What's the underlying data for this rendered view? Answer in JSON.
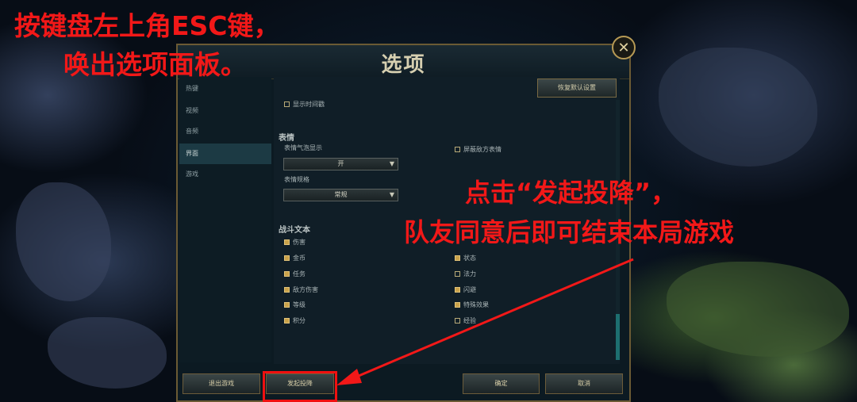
{
  "annotations": {
    "top_line1": "按键盘左上角ESC键，",
    "top_line2": "唤出选项面板。",
    "right_line1": "点击“发起投降”，",
    "right_line2": "队友同意后即可结束本局游戏"
  },
  "dialog": {
    "title": "选项",
    "close_symbol": "✕",
    "reset_button": "恢复默认设置"
  },
  "sidebar": {
    "items": [
      {
        "label": "热键",
        "active": false
      },
      {
        "label": "视频",
        "active": false
      },
      {
        "label": "音频",
        "active": false
      },
      {
        "label": "界面",
        "active": true
      },
      {
        "label": "游戏",
        "active": false
      }
    ]
  },
  "settings": {
    "show_timestamps": {
      "label": "显示时间戳",
      "checked": false
    },
    "emotes": {
      "heading": "表情",
      "bubble_label": "表情气泡显示",
      "bubble_value": "开",
      "size_label": "表情规格",
      "size_value": "常规",
      "mute_enemy": {
        "label": "屏蔽敌方表情",
        "checked": false
      }
    },
    "combat_text": {
      "heading": "战斗文本",
      "left": [
        {
          "label": "伤害",
          "checked": true
        },
        {
          "label": "金币",
          "checked": true
        },
        {
          "label": "任务",
          "checked": true
        },
        {
          "label": "敌方伤害",
          "checked": true
        },
        {
          "label": "等级",
          "checked": true
        },
        {
          "label": "积分",
          "checked": true
        }
      ],
      "right": [
        {
          "label": "状态",
          "checked": true
        },
        {
          "label": "法力",
          "checked": false
        },
        {
          "label": "闪避",
          "checked": true
        },
        {
          "label": "特殊效果",
          "checked": true
        },
        {
          "label": "经验",
          "checked": false
        }
      ]
    }
  },
  "footer": {
    "exit_game": "退出游戏",
    "surrender": "发起投降",
    "ok": "确定",
    "cancel": "取消"
  },
  "colors": {
    "annotation_red": "#f21818",
    "gold_border": "#6b5a34"
  }
}
